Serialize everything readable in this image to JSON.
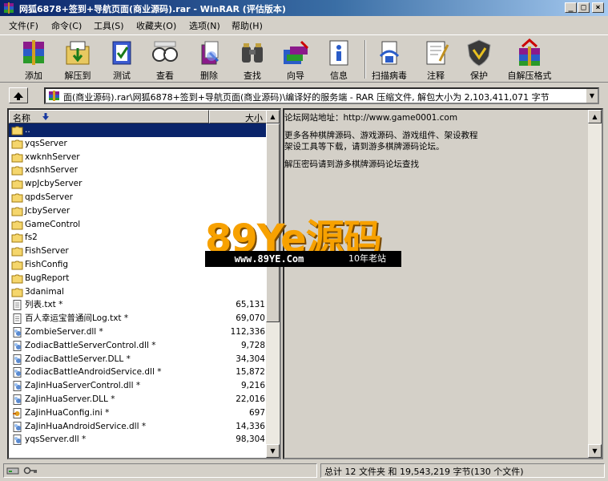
{
  "window": {
    "title": "网狐6878+签到+导航页面(商业源码).rar - WinRAR (评估版本)"
  },
  "menu": [
    "文件(F)",
    "命令(C)",
    "工具(S)",
    "收藏夹(O)",
    "选项(N)",
    "帮助(H)"
  ],
  "toolbar": [
    {
      "label": "添加",
      "icon": "add-archive-icon"
    },
    {
      "label": "解压到",
      "icon": "extract-to-icon"
    },
    {
      "label": "测试",
      "icon": "test-icon"
    },
    {
      "label": "查看",
      "icon": "view-icon"
    },
    {
      "label": "删除",
      "icon": "delete-icon"
    },
    {
      "label": "查找",
      "icon": "find-icon"
    },
    {
      "label": "向导",
      "icon": "wizard-icon"
    },
    {
      "label": "信息",
      "icon": "info-icon"
    },
    {
      "label": "扫描病毒",
      "icon": "virus-scan-icon"
    },
    {
      "label": "注释",
      "icon": "comment-icon"
    },
    {
      "label": "保护",
      "icon": "protect-icon"
    },
    {
      "label": "自解压格式",
      "icon": "sfx-icon"
    }
  ],
  "address": {
    "path": "面(商业源码).rar\\网狐6878+签到+导航页面(商业源码)\\编译好的服务端 - RAR 压缩文件, 解包大小为 2,103,411,071 字节"
  },
  "filelist": {
    "columns": {
      "name": "名称",
      "size": "大小"
    },
    "rows": [
      {
        "name": "..",
        "size": "",
        "type": "folder",
        "selected": true
      },
      {
        "name": "yqsServer",
        "size": "",
        "type": "folder"
      },
      {
        "name": "xwknhServer",
        "size": "",
        "type": "folder"
      },
      {
        "name": "xdsnhServer",
        "size": "",
        "type": "folder"
      },
      {
        "name": "wpJcbyServer",
        "size": "",
        "type": "folder"
      },
      {
        "name": "qpdsServer",
        "size": "",
        "type": "folder"
      },
      {
        "name": "JcbyServer",
        "size": "",
        "type": "folder"
      },
      {
        "name": "GameControl",
        "size": "",
        "type": "folder"
      },
      {
        "name": "fs2",
        "size": "",
        "type": "folder"
      },
      {
        "name": "FishServer",
        "size": "",
        "type": "folder"
      },
      {
        "name": "FishConfig",
        "size": "",
        "type": "folder"
      },
      {
        "name": "BugReport",
        "size": "",
        "type": "folder"
      },
      {
        "name": "3danimal",
        "size": "",
        "type": "folder"
      },
      {
        "name": "列表.txt *",
        "size": "65,131",
        "type": "txt"
      },
      {
        "name": "百人幸运宝普通间Log.txt *",
        "size": "69,070",
        "type": "txt"
      },
      {
        "name": "ZombieServer.dll *",
        "size": "112,336",
        "type": "dll"
      },
      {
        "name": "ZodiacBattleServerControl.dll *",
        "size": "9,728",
        "type": "dll"
      },
      {
        "name": "ZodiacBattleServer.DLL *",
        "size": "34,304",
        "type": "dll"
      },
      {
        "name": "ZodiacBattleAndroidService.dll *",
        "size": "15,872",
        "type": "dll"
      },
      {
        "name": "ZaJinHuaServerControl.dll *",
        "size": "9,216",
        "type": "dll"
      },
      {
        "name": "ZaJinHuaServer.DLL *",
        "size": "22,016",
        "type": "dll"
      },
      {
        "name": "ZaJinHuaConfig.ini *",
        "size": "697",
        "type": "ini"
      },
      {
        "name": "ZaJinHuaAndroidService.dll *",
        "size": "14,336",
        "type": "dll"
      },
      {
        "name": "yqsServer.dll *",
        "size": "98,304",
        "type": "dll"
      }
    ]
  },
  "comment": {
    "lines": [
      "论坛网站地址：http://www.game0001.com",
      "",
      "更多各种棋牌源码、游戏源码、游戏组件、架设教程",
      "架设工具等下载，请到游多棋牌源码论坛。",
      "",
      "解压密码请到游多棋牌源码论坛查找"
    ]
  },
  "watermark": {
    "brand": "89Ye源码",
    "url": "www.89YE.Com",
    "tag": "10年老站"
  },
  "status": {
    "summary": "总计 12 文件夹 和 19,543,219 字节(130 个文件)"
  },
  "colors": {
    "title_start": "#0a246a",
    "title_end": "#a6caf0",
    "selection": "#0a246a",
    "logo_orange": "#f7a100"
  }
}
